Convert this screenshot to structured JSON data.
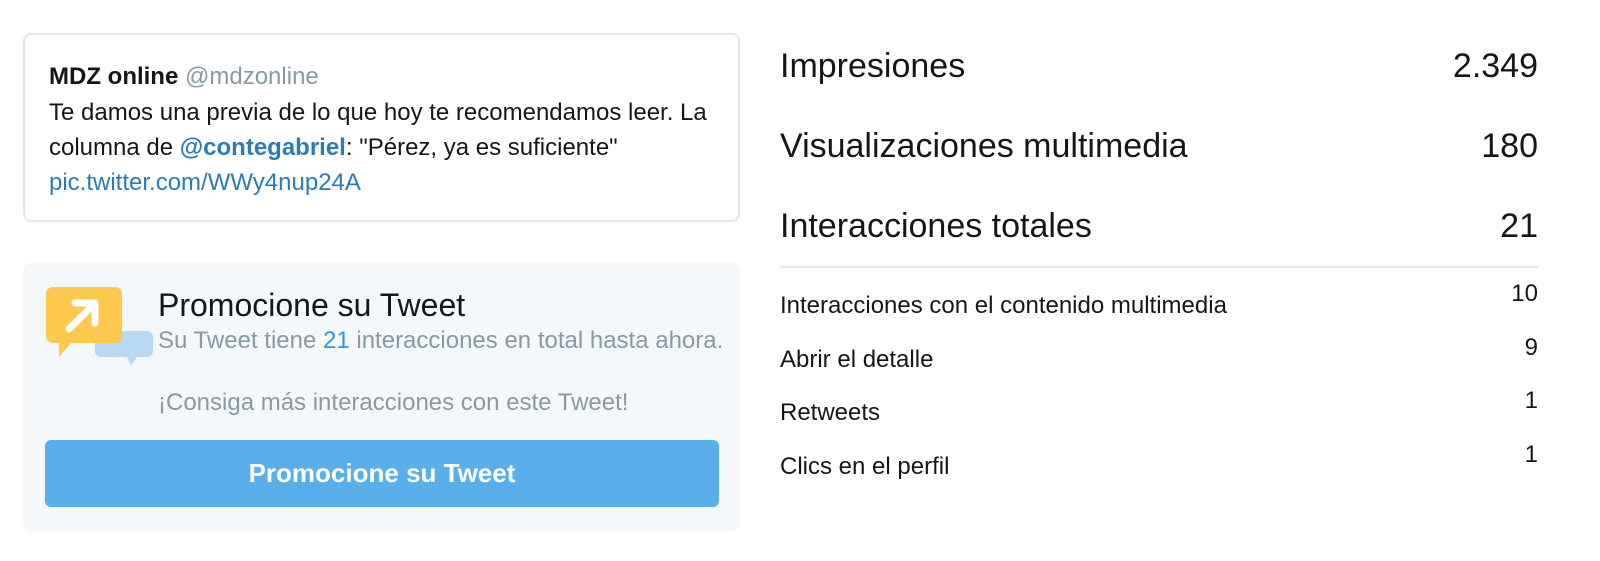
{
  "tweet": {
    "author": "MDZ online",
    "handle": "@mdzonline",
    "text_part1": "Te damos una previa de lo que hoy te recomendamos leer. La columna de ",
    "mention": "@contegabriel",
    "text_part2": ": \"Pérez, ya es suficiente\" ",
    "link": "pic.twitter.com/WWy4nup24A"
  },
  "promo": {
    "title": "Promocione su Tweet",
    "desc_prefix": "Su Tweet tiene ",
    "desc_count": "21",
    "desc_suffix": " interacciones en total hasta ahora.",
    "cta": "¡Consiga más interacciones con este Tweet!",
    "button_label": "Promocione su Tweet",
    "icon": "promote-arrow-icon",
    "colors": {
      "icon_bg": "#ffc84e",
      "bubble": "#b9d9f2",
      "button": "#5aaeea"
    }
  },
  "metrics": {
    "summary": [
      {
        "label": "Impresiones",
        "value": "2.349"
      },
      {
        "label": "Visualizaciones multimedia",
        "value": "180"
      },
      {
        "label": "Interacciones totales",
        "value": "21"
      }
    ],
    "details": [
      {
        "label": "Interacciones con el contenido multimedia",
        "value": "10"
      },
      {
        "label": "Abrir el detalle",
        "value": "9"
      },
      {
        "label": "Retweets",
        "value": "1"
      },
      {
        "label": "Clics en el perfil",
        "value": "1"
      }
    ]
  }
}
